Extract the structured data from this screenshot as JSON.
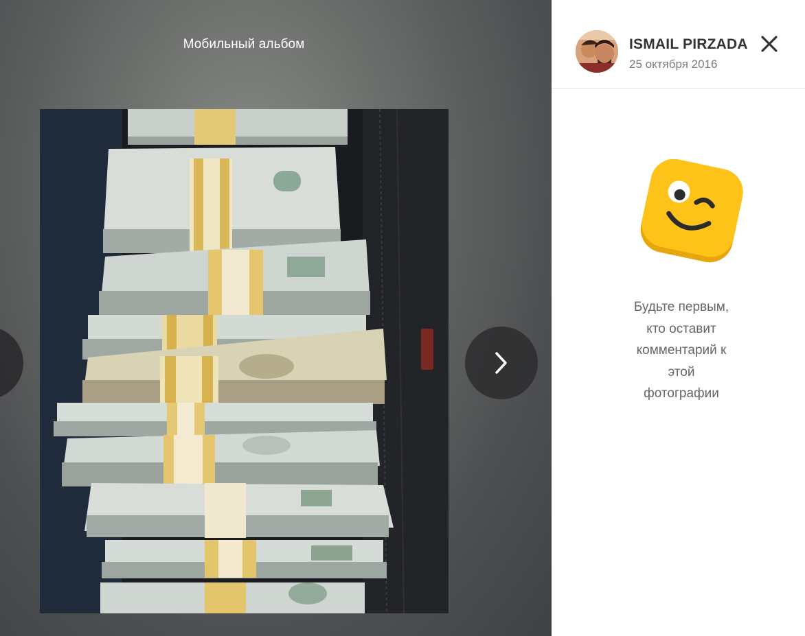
{
  "viewer": {
    "album_title": "Мобильный альбом",
    "photo_icon": "money-stacks-photo",
    "prev_icon": "chevron-left-icon",
    "next_icon": "chevron-right-icon"
  },
  "sidebar": {
    "author_name": "ISMAIL PIRZADA",
    "post_date": "25 октября 2016",
    "close_icon": "close-icon",
    "emoji_icon": "winking-smiley-icon",
    "empty_comments_lines": [
      "Будьте первым,",
      "кто оставит",
      "комментарий к",
      "этой",
      "фотографии"
    ]
  },
  "colors": {
    "viewer_bg": "#5a5c5e",
    "emoji_yellow": "#FDC318",
    "text_gray": "#666666"
  }
}
